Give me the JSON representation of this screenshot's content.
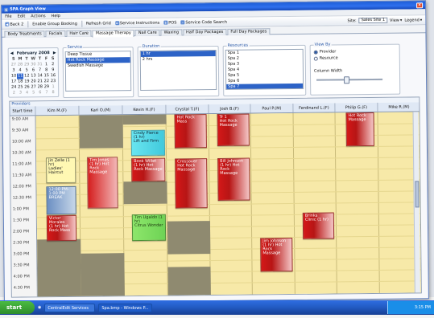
{
  "window": {
    "title": "SPA Graph View"
  },
  "menu": [
    "File",
    "Edit",
    "Actions",
    "Help"
  ],
  "toolbar": {
    "back": "Back 2",
    "enable": "Enable Group Booking",
    "refresh": "Refresh Grid",
    "instructions": "Service Instructions",
    "pos": "POS",
    "search": "Service Code Search",
    "site_label": "Site:",
    "site_value": "Sales Site 1",
    "view": "View",
    "legend": "Legend"
  },
  "tabs": [
    "Body Treatments",
    "Facials",
    "Hair Care",
    "Massage Therapy",
    "Nail Care",
    "Waxing",
    "Half Day Packages",
    "Full Day Packages"
  ],
  "active_tab": "Massage Therapy",
  "calendar": {
    "month": "February 2008",
    "days": [
      "S",
      "M",
      "T",
      "W",
      "T",
      "F",
      "S"
    ],
    "rows": [
      [
        "27",
        "28",
        "29",
        "30",
        "31",
        "1",
        "2"
      ],
      [
        "3",
        "4",
        "5",
        "6",
        "7",
        "8",
        "9"
      ],
      [
        "10",
        "11",
        "12",
        "13",
        "14",
        "15",
        "16"
      ],
      [
        "17",
        "18",
        "19",
        "20",
        "21",
        "22",
        "23"
      ],
      [
        "24",
        "25",
        "26",
        "27",
        "28",
        "29",
        "1"
      ],
      [
        "2",
        "3",
        "4",
        "5",
        "6",
        "7",
        "8"
      ]
    ],
    "selected": "11"
  },
  "service": {
    "label": "Service",
    "items": [
      "Deep Tissue",
      "Hot Rock Massage",
      "Swedish Massage"
    ],
    "selected": "Hot Rock Massage"
  },
  "duration": {
    "label": "Duration",
    "items": [
      "1 hr",
      "2 hrs"
    ],
    "selected": "1 hr"
  },
  "resources": {
    "label": "Resources",
    "items": [
      "Spa 1",
      "Spa 2",
      "Spa 3",
      "Spa 4",
      "Spa 5",
      "Spa 6",
      "Spa 7"
    ],
    "selected": "Spa 7"
  },
  "view_by": {
    "label": "View By",
    "options": [
      "Provider",
      "Resource"
    ],
    "selected": "Provider",
    "column_width": "Column Width"
  },
  "schedule": {
    "label": "Providers",
    "start_time": "Start time",
    "columns": [
      "Kim M.(F)",
      "Kari O.(M)",
      "Kevin H.(F)",
      "Crystal T.(F)",
      "Josh B.(F)",
      "Paul P.(M)",
      "Ferdinand L.(F)",
      "Philip G.(F)",
      "Mike R.(M)"
    ],
    "times": [
      "9:00 AM",
      "9:30 AM",
      "10:00 AM",
      "10:30 AM",
      "11:00 AM",
      "11:30 AM",
      "12:00 PM",
      "12:30 PM",
      "1:00 PM",
      "1:30 PM",
      "2:00 PM",
      "2:30 PM",
      "3:00 PM",
      "3:30 PM",
      "4:00 PM",
      "4:30 PM"
    ]
  },
  "appointments": [
    {
      "title": "Hot Rock Mass",
      "meta": "",
      "color": "red"
    },
    {
      "title": "Tr 1",
      "meta": "Hot Rock Massage",
      "color": "red"
    },
    {
      "title": "Hot Rock Massage",
      "meta": "",
      "color": "red"
    },
    {
      "title": "Cindy Pierce (1 hr)",
      "meta": "Lift and Firm",
      "color": "cyan"
    },
    {
      "title": "Jin Zelle (1 hr)",
      "meta": "Ladies' Haircut",
      "color": "yellow"
    },
    {
      "title": "Tim Jones",
      "meta": "(1 hr) Hot Rock Massage",
      "color": "lightred"
    },
    {
      "title": "Book Willet",
      "meta": "(1 hr) Hot Rock Massage",
      "color": "red"
    },
    {
      "title": "Crossover",
      "meta": "Hot Rock Massage",
      "color": "red"
    },
    {
      "title": "Bill Johnson",
      "meta": "(1 hr) Hot Rock Massage",
      "color": "red"
    },
    {
      "title": "12:00 PM-1:00 PM",
      "meta": "BREAK",
      "color": "blue"
    },
    {
      "title": "Victor Morales",
      "meta": "(1 hr) Hot Rock Mass",
      "color": "red"
    },
    {
      "title": "Tim Ugaldo (1 hr)",
      "meta": "Citrus Wonder",
      "color": "green"
    },
    {
      "title": "Brinks",
      "meta": "Clinic (1 hr)",
      "color": "red"
    },
    {
      "title": "Jim Johnson",
      "meta": "(1 hr) Hot Rock Massage",
      "color": "red"
    }
  ],
  "taskbar": {
    "start": "start",
    "items": [
      "CentralEdit Services",
      "Spa.bmp - Windows P..."
    ],
    "clock": "3:15 PM"
  }
}
